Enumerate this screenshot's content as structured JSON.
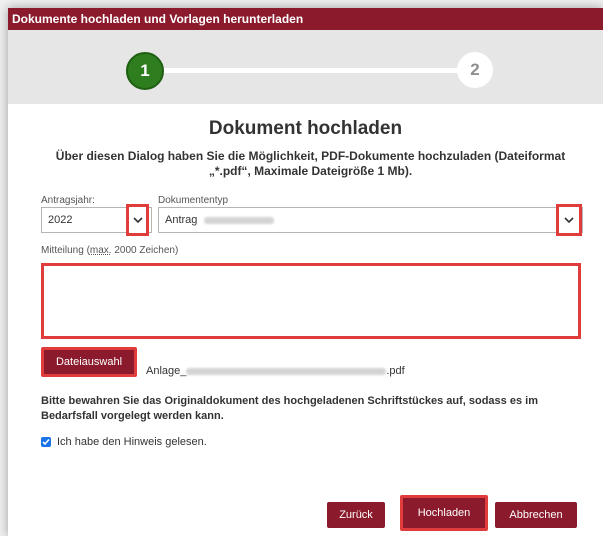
{
  "dialog": {
    "title": "Dokumente hochladen und Vorlagen herunterladen"
  },
  "stepper": {
    "step1": "1",
    "step2": "2"
  },
  "main": {
    "heading": "Dokument hochladen",
    "intro": "Über diesen Dialog haben Sie die Möglichkeit, PDF-Dokumente hochzuladen (Dateiformat „*.pdf“, Maximale Dateigröße 1 Mb)."
  },
  "form": {
    "year_label": "Antragsjahr:",
    "year_value": "2022",
    "doctype_label": "Dokumententyp",
    "doctype_value_prefix": "Antrag",
    "message_label_prefix": "Mitteilung (",
    "message_label_abbr": "max.",
    "message_label_suffix": " 2000 Zeichen)",
    "file_button": "Dateiauswahl",
    "filename_prefix": "Anlage_",
    "filename_suffix": ".pdf",
    "notice": "Bitte bewahren Sie das Originaldokument des hochgeladenen Schriftstückes auf, sodass es im Bedarfsfall vorgelegt werden kann.",
    "checkbox_label": "Ich habe den Hinweis gelesen.",
    "checkbox_checked": true
  },
  "buttons": {
    "back": "Zurück",
    "upload": "Hochladen",
    "cancel": "Abbrechen"
  },
  "colors": {
    "brand": "#8a1a2c",
    "step_active": "#2e7d1e",
    "highlight": "#e03c3c",
    "checkbox": "#1a73e8"
  }
}
